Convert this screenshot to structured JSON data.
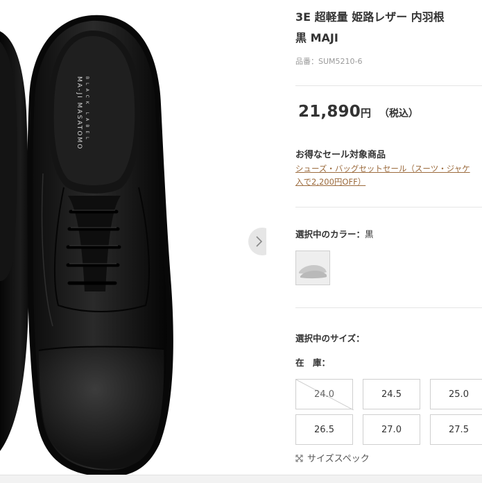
{
  "gallery": {
    "insole_brand_line1": "MA-JI MASATOMO",
    "insole_brand_line2": "BLACK LABEL",
    "next_arrow_icon": "chevron-right-icon"
  },
  "product": {
    "title_line1": "3E 超軽量 姫路レザー 内羽根",
    "title_line2": "黒 MAJI",
    "item_code": "品番：SUM5210-6",
    "price_number": "21,890",
    "price_unit": "円",
    "price_tax": "（税込）"
  },
  "sale": {
    "heading": "お得なセール対象商品",
    "link_line1": "シューズ・バッグセットセール（スーツ・ジャケ",
    "link_line2": "入で2,200円OFF）"
  },
  "color": {
    "label": "選択中のカラー：",
    "value": "黒"
  },
  "size": {
    "label": "選択中のサイズ：",
    "stock_label": "在　庫：",
    "options": [
      {
        "label": "24.0",
        "available": false
      },
      {
        "label": "24.5",
        "available": true
      },
      {
        "label": "25.0",
        "available": true
      },
      {
        "label": "26.5",
        "available": true
      },
      {
        "label": "27.0",
        "available": true
      },
      {
        "label": "27.5",
        "available": true
      }
    ],
    "spec_link": "サイズスペック",
    "spec_icon": "expand-icon"
  },
  "colors": {
    "price_text": "#333333",
    "link_color": "#9b6a3c",
    "border": "#cfcfcf"
  }
}
